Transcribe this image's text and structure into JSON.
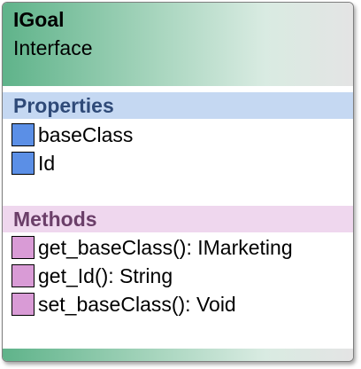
{
  "class_box": {
    "name": "IGoal",
    "stereotype": "Interface",
    "properties_section": {
      "title": "Properties",
      "items": [
        {
          "label": "baseClass",
          "icon": "property-icon"
        },
        {
          "label": "Id",
          "icon": "property-icon"
        }
      ]
    },
    "methods_section": {
      "title": "Methods",
      "items": [
        {
          "label": "get_baseClass(): IMarketing",
          "icon": "method-icon"
        },
        {
          "label": "get_Id(): String",
          "icon": "method-icon"
        },
        {
          "label": "set_baseClass(): Void",
          "icon": "method-icon"
        }
      ]
    }
  },
  "colors": {
    "header_gradient_start": "#5fb38a",
    "properties_band": "#c5d8f2",
    "properties_title": "#2f4a78",
    "property_icon": "#5b8fe6",
    "methods_band": "#efd7ee",
    "methods_title": "#6b3f69",
    "method_icon": "#d99bd6"
  }
}
